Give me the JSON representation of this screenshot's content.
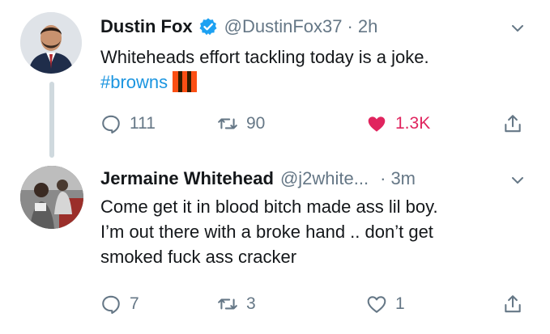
{
  "tweets": [
    {
      "name": "Dustin Fox",
      "handle": "@DustinFox37",
      "separator": "·",
      "time": "2h",
      "verified": true,
      "text_before": "Whiteheads effort tackling today is a joke.",
      "hashtag": "#browns",
      "stats": {
        "replies": "111",
        "retweets": "90",
        "likes": "1.3K"
      },
      "liked": true
    },
    {
      "name": "Jermaine Whitehead",
      "handle": "@j2white...",
      "separator": "·",
      "time": "3m",
      "verified": false,
      "lines": [
        "Come get it in blood bitch made ass lil boy.",
        "I’m out there with a broke hand .. don’t get",
        "smoked fuck ass cracker"
      ],
      "stats": {
        "replies": "7",
        "retweets": "3",
        "likes": "1"
      },
      "liked": false
    }
  ],
  "colors": {
    "link": "#1b95e0",
    "like": "#e0245e",
    "muted": "#657786",
    "verified": "#1da1f2",
    "flag_orange": "#fb4f14",
    "flag_brown": "#311d00"
  }
}
